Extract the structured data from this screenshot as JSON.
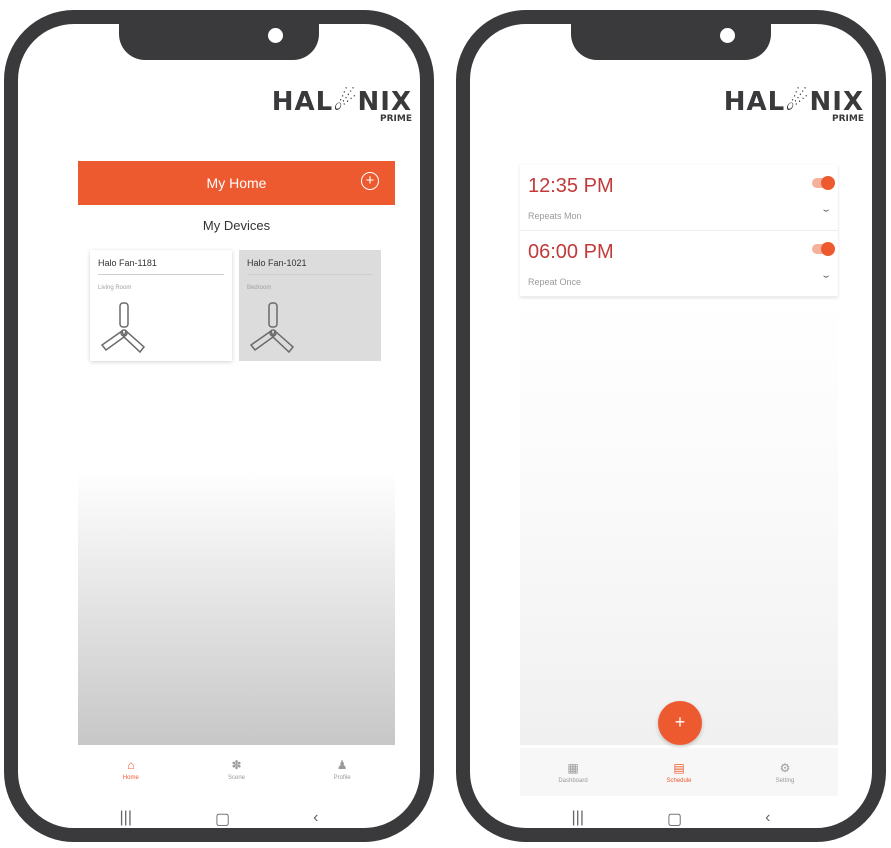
{
  "brand": {
    "logo_text": "HAL☄NIX",
    "logo_sub": "PRIME"
  },
  "left_phone": {
    "header": {
      "title": "My Home",
      "add_icon": "plus-circle-icon"
    },
    "devices_title": "My Devices",
    "devices": [
      {
        "name": "Halo Fan-1181",
        "room": "Living Room",
        "selected": false
      },
      {
        "name": "Halo Fan-1021",
        "room": "Bedroom",
        "selected": true
      }
    ],
    "nav": [
      {
        "label": "Home",
        "icon": "home-icon",
        "active": true
      },
      {
        "label": "Scene",
        "icon": "scene-icon",
        "active": false
      },
      {
        "label": "Profile",
        "icon": "profile-icon",
        "active": false
      }
    ]
  },
  "right_phone": {
    "schedules": [
      {
        "time": "12:35 PM",
        "repeat": "Repeats Mon",
        "enabled": true
      },
      {
        "time": "06:00 PM",
        "repeat": "Repeat Once",
        "enabled": true
      }
    ],
    "fab_label": "+",
    "nav": [
      {
        "label": "Dashboard",
        "icon": "dashboard-icon",
        "active": false
      },
      {
        "label": "Schedule",
        "icon": "calendar-icon",
        "active": true
      },
      {
        "label": "Setting",
        "icon": "gear-icon",
        "active": false
      }
    ]
  },
  "system_nav": {
    "recent": "|||",
    "home": "▢",
    "back": "‹"
  },
  "colors": {
    "accent": "#ee5a2f",
    "time_text": "#c23a3a",
    "frame": "#3a3a3c"
  }
}
